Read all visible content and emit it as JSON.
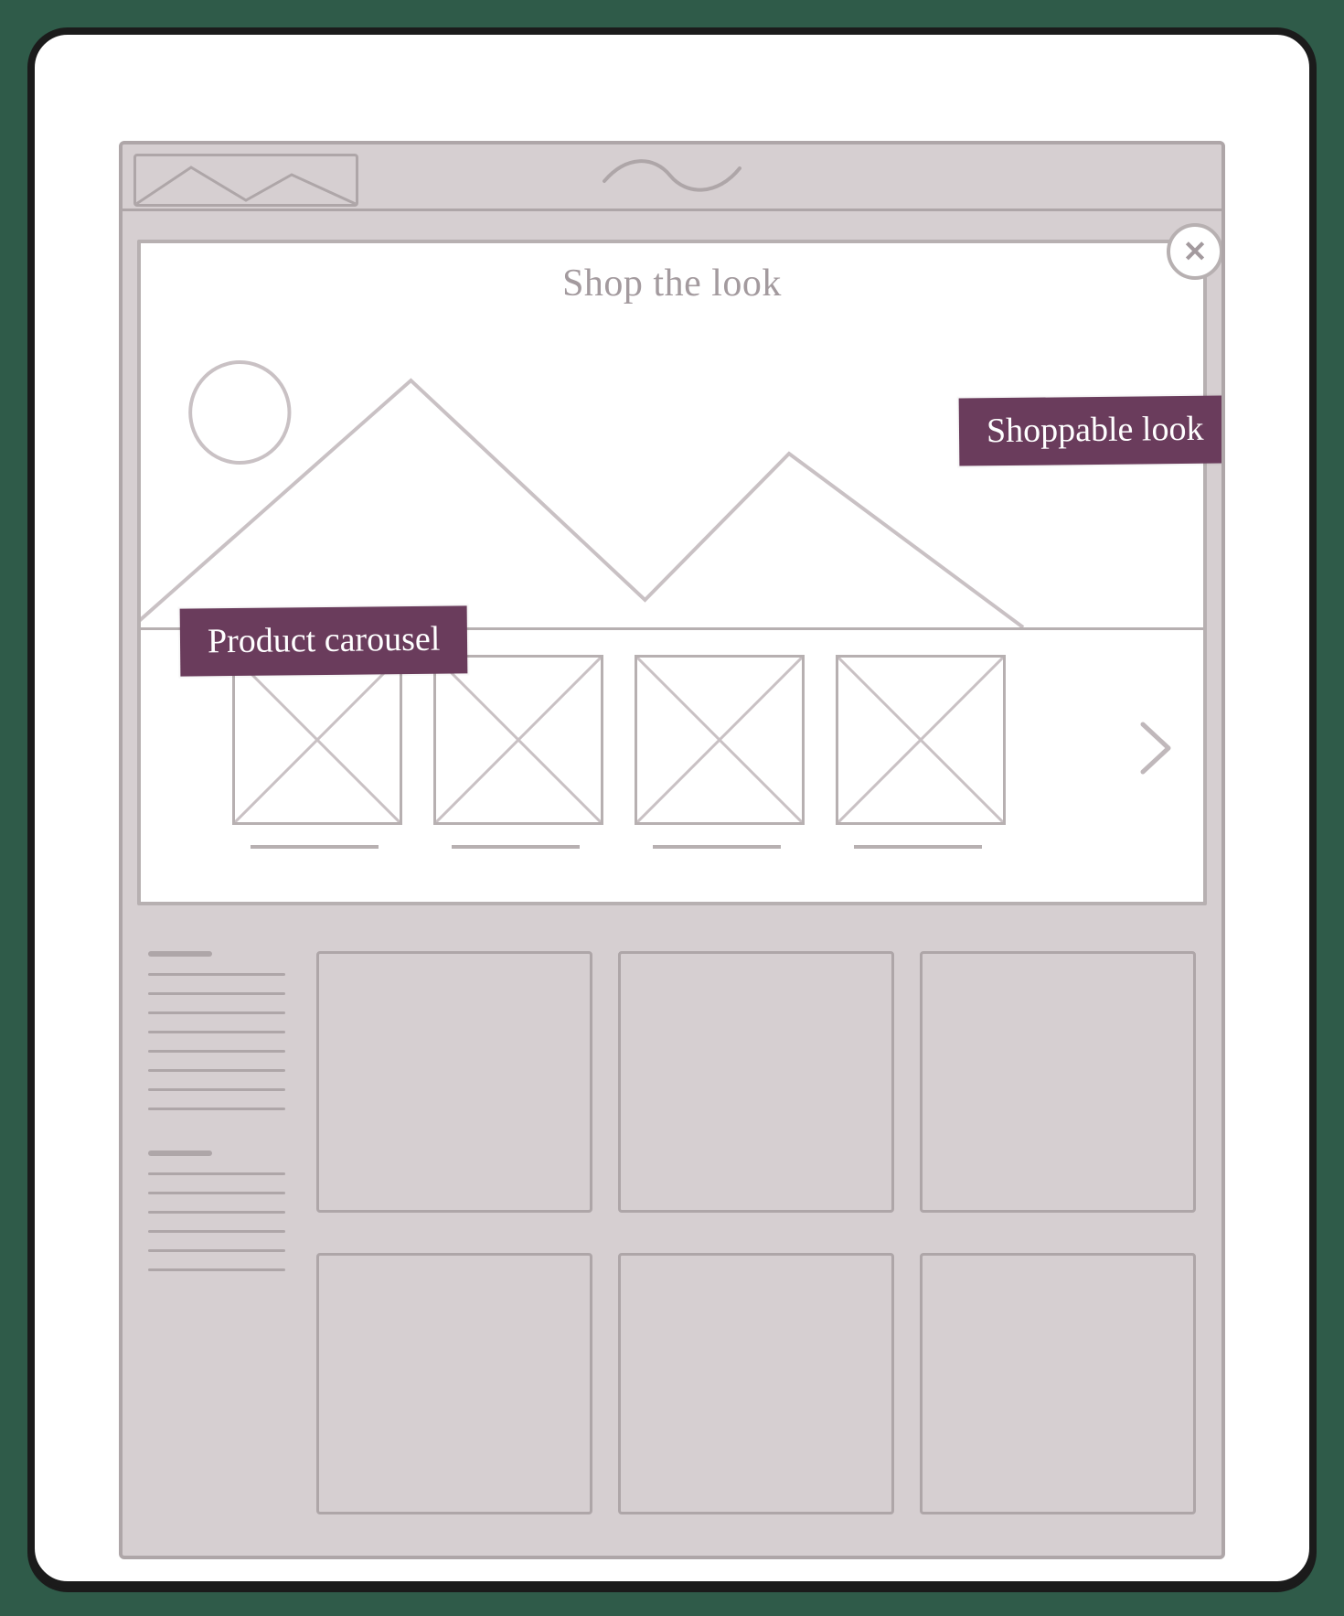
{
  "modal": {
    "title": "Shop the look"
  },
  "annotations": {
    "shoppable_look": "Shoppable look",
    "product_carousel": "Product carousel"
  },
  "icons": {
    "close": "close-icon",
    "next": "chevron-right-icon",
    "hero_placeholder": "image-placeholder-icon"
  },
  "carousel": {
    "item_count": 4
  },
  "background_grid": {
    "rows": 2,
    "cols": 3
  }
}
